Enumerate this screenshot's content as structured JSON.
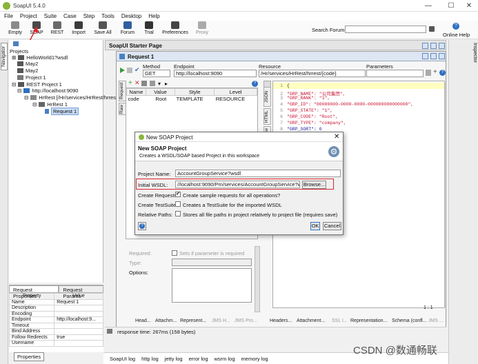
{
  "window": {
    "title": "SoapUI 5.4.0",
    "controls": [
      "—",
      "☐",
      "✕"
    ]
  },
  "menu": [
    "File",
    "Project",
    "Suite",
    "Case",
    "Step",
    "Tools",
    "Desktop",
    "Help"
  ],
  "toolbar": {
    "buttons": [
      "Empty",
      "SOAP",
      "REST",
      "Import",
      "Save All",
      "Forum",
      "Trial",
      "Preferences",
      "Proxy"
    ],
    "search_label": "Search Forum",
    "help_label": "Online Help"
  },
  "navigator": {
    "label": "Navigator",
    "projects_label": "Projects"
  },
  "tree": [
    "HelloWorld1?wsdl",
    "May2",
    "May2",
    "Project 1",
    "REST Project 1",
    "http://localhost:9090",
    "HrRest [/Hr/services/HrRest/hrrest]",
    "HrRest 1",
    "Request 1"
  ],
  "request_props": {
    "tabs": [
      "Request Properties",
      "Request Params"
    ],
    "headers": [
      "Property",
      "Value"
    ],
    "rows": [
      [
        "Name",
        "Request 1"
      ],
      [
        "Description",
        ""
      ],
      [
        "Encoding",
        ""
      ],
      [
        "Endpoint",
        "http://localhost:9..."
      ],
      [
        "Timeout",
        ""
      ],
      [
        "Bind Address",
        ""
      ],
      [
        "Follow Redirects",
        "true"
      ],
      [
        "Username",
        ""
      ]
    ],
    "button": "Properties"
  },
  "starter": {
    "title": "SoapUI Starter Page"
  },
  "request": {
    "title": "Request 1",
    "method_label": "Method",
    "method_value": "GET",
    "endpoint_label": "Endpoint",
    "endpoint_value": "http://localhost:9090",
    "resource_label": "Resource",
    "resource_value": "/Hr/services/HrRest/hrrest/{code}",
    "parameters_label": "Parameters",
    "side_tabs": [
      "Request",
      "Raw"
    ],
    "json_tabs": [
      "JSON",
      "HTML",
      "Raw"
    ],
    "table_headers": [
      "Name",
      "Value",
      "Style",
      "Level"
    ],
    "table_row": [
      "code",
      "Root",
      "TEMPLATE",
      "RESOURCE"
    ],
    "param_labels": [
      "Required:",
      "Sets if parameter is required",
      "Type:",
      "Options:"
    ],
    "bottom_tabs_left": [
      "Head...",
      "Attachm...",
      "Represent...",
      "JMS H...",
      "JMS Pro..."
    ],
    "bottom_tabs_right": [
      "Headers...",
      "Attachment...",
      "SSL I...",
      "Representation...",
      "Schema (confl...",
      "JMS ..."
    ],
    "position": "1 : 1",
    "response_time": "response time: 267ms (158 bytes)"
  },
  "json_lines": [
    "{",
    "\"GRP_NAME\": \"公司集团\",",
    "\"GRP_RANK\": \"1\",",
    "\"GRP_ID\": \"00000000-0000-0000-000000000000000\",",
    "\"GRP_STATE\": \"1\",",
    "\"GRP_CODE\": \"Root\",",
    "\"GRP_TYPE\": \"company\",",
    "\"GRP_SORT\": 0"
  ],
  "dialog": {
    "title": "New SOAP Project",
    "heading": "New SOAP Project",
    "subheading": "Creates a WSDL/SOAP based Project in this workspace",
    "project_name_label": "Project Name:",
    "project_name_value": "AccountGroupService?wsdl",
    "wsdl_label": "Initial WSDL:",
    "wsdl_value": "//localhost:9090/Pm/services/AccountGroupService?wsdl",
    "browse": "Browse...",
    "create_requests_label": "Create Requests:",
    "create_requests_text": "Create sample requests for all operations?",
    "create_testsuite_label": "Create TestSuite:",
    "create_testsuite_text": "Creates a TestSuite for the imported WSDL",
    "relative_paths_label": "Relative Paths:",
    "relative_paths_text": "Stores all file paths in project relatively to project file (requires save)",
    "ok": "OK",
    "cancel": "Cancel",
    "help_icon_char": "?",
    "create_requests_checked": true,
    "create_testsuite_checked": false,
    "relative_paths_checked": false
  },
  "inspector": {
    "label": "Inspector"
  },
  "logs": [
    "SoapUI log",
    "http log",
    "jetty log",
    "error log",
    "wsrm log",
    "memory log"
  ],
  "watermark": "CSDN @数通畅联",
  "colors": {
    "highlight_red": "#d9262b",
    "accent_green": "#3a9b3a",
    "json_highlight": "#ffffc0"
  }
}
